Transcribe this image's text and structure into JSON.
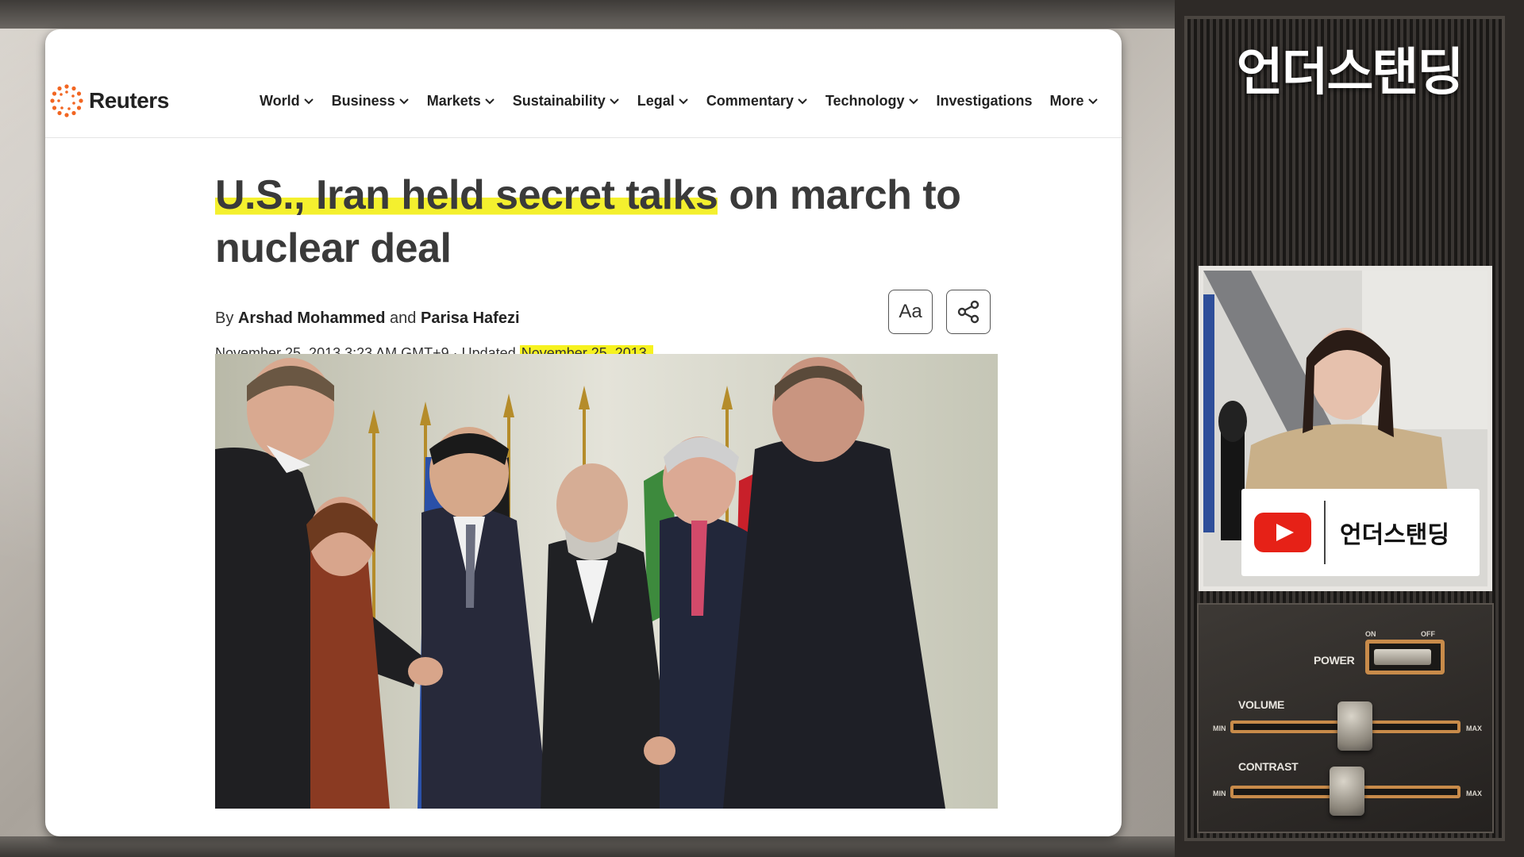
{
  "site": {
    "logo_text": "Reuters",
    "nav": [
      {
        "label": "World",
        "has_menu": true
      },
      {
        "label": "Business",
        "has_menu": true
      },
      {
        "label": "Markets",
        "has_menu": true
      },
      {
        "label": "Sustainability",
        "has_menu": true
      },
      {
        "label": "Legal",
        "has_menu": true
      },
      {
        "label": "Commentary",
        "has_menu": true
      },
      {
        "label": "Technology",
        "has_menu": true
      },
      {
        "label": "Investigations",
        "has_menu": false
      },
      {
        "label": "More",
        "has_menu": true
      }
    ]
  },
  "article": {
    "headline_highlight": "U.S., Iran held secret talks",
    "headline_rest": " on march to nuclear deal",
    "byline_prefix": "By ",
    "author1": "Arshad Mohammed",
    "byline_and": " and ",
    "author2": "Parisa Hafezi",
    "published": "November 25, 2013 3:23 AM GMT+9 · Updated ",
    "updated": "November 25, 2013",
    "font_button": "Aa",
    "share_icon": "share-icon"
  },
  "channel": {
    "title": "언더스탠딩",
    "yt_name": "언더스탠딩",
    "controls": {
      "power": "POWER",
      "on": "ON",
      "off": "OFF",
      "volume": "VOLUME",
      "contrast": "CONTRAST",
      "min": "MIN",
      "max": "MAX"
    }
  },
  "colors": {
    "highlight": "#f4f02e",
    "youtube_red": "#e62117"
  }
}
